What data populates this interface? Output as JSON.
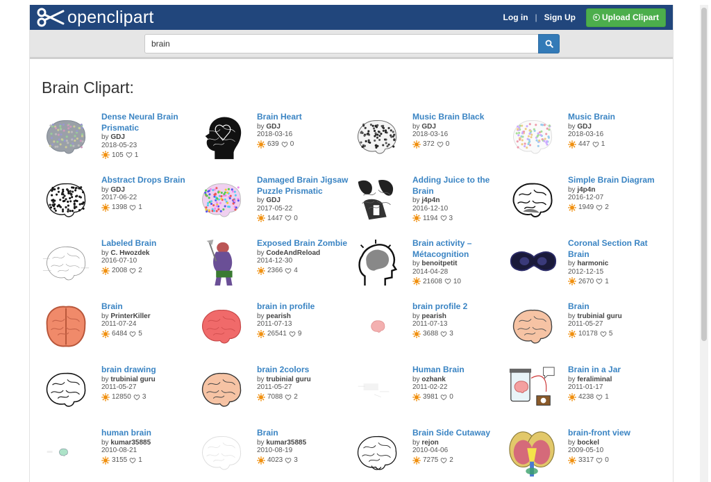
{
  "header": {
    "logo_text": "openclipart",
    "login_label": "Log in",
    "separator": "|",
    "signup_label": "Sign Up",
    "upload_label": "Upload Clipart"
  },
  "search": {
    "value": "brain"
  },
  "page": {
    "heading": "Brain Clipart:"
  },
  "colors": {
    "header_bg": "#21467c",
    "link": "#3a84c3",
    "upload_bg": "#4cae4c",
    "search_btn": "#337ab7"
  },
  "items": [
    {
      "title": "Dense Neural Brain Prismatic",
      "author": "GDJ",
      "date": "2018-05-23",
      "downloads": "105",
      "likes": "1",
      "icon": "prismatic-brain-thumbnail"
    },
    {
      "title": "Brain Heart",
      "author": "GDJ",
      "date": "2018-03-16",
      "downloads": "639",
      "likes": "0",
      "icon": "head-silhouette-heart-thumbnail"
    },
    {
      "title": "Music Brain Black",
      "author": "GDJ",
      "date": "2018-03-16",
      "downloads": "372",
      "likes": "0",
      "icon": "music-notes-brain-thumbnail"
    },
    {
      "title": "Music Brain",
      "author": "GDJ",
      "date": "2018-03-16",
      "downloads": "447",
      "likes": "1",
      "icon": "colorful-music-brain-thumbnail"
    },
    {
      "title": "Abstract Drops Brain",
      "author": "GDJ",
      "date": "2017-06-22",
      "downloads": "1398",
      "likes": "1",
      "icon": "drops-brain-thumbnail"
    },
    {
      "title": "Damaged Brain Jigsaw Puzzle Prismatic",
      "author": "GDJ",
      "date": "2017-05-22",
      "downloads": "1447",
      "likes": "0",
      "icon": "jigsaw-brain-thumbnail"
    },
    {
      "title": "Adding Juice to the Brain",
      "author": "j4p4n",
      "date": "2016-12-10",
      "downloads": "1194",
      "likes": "3",
      "icon": "juice-illustration-thumbnail"
    },
    {
      "title": "Simple Brain Diagram",
      "author": "j4p4n",
      "date": "2016-12-07",
      "downloads": "1949",
      "likes": "2",
      "icon": "brain-diagram-thumbnail"
    },
    {
      "title": "Labeled Brain",
      "author": "C. Hwozdek",
      "date": "2016-07-10",
      "downloads": "2008",
      "likes": "2",
      "icon": "labeled-brain-thumbnail"
    },
    {
      "title": "Exposed Brain Zombie",
      "author": "CodeAndReload",
      "date": "2014-12-30",
      "downloads": "2366",
      "likes": "4",
      "icon": "zombie-thumbnail"
    },
    {
      "title": "Brain activity – Métacognition",
      "author": "benoitpetit",
      "date": "2014-04-28",
      "downloads": "21608",
      "likes": "10",
      "icon": "head-outline-thumbnail"
    },
    {
      "title": "Coronal Section Rat Brain",
      "author": "harmonic",
      "date": "2012-12-15",
      "downloads": "2670",
      "likes": "1",
      "icon": "rat-brain-section-thumbnail"
    },
    {
      "title": "Brain",
      "author": "PrinterKiller",
      "date": "2011-07-24",
      "downloads": "6484",
      "likes": "5",
      "icon": "orange-brain-thumbnail"
    },
    {
      "title": "brain in profile",
      "author": "pearish",
      "date": "2011-07-13",
      "downloads": "26541",
      "likes": "9",
      "icon": "red-brain-profile-thumbnail"
    },
    {
      "title": "brain profile 2",
      "author": "pearish",
      "date": "2011-07-13",
      "downloads": "3688",
      "likes": "3",
      "icon": "small-brain-thumbnail"
    },
    {
      "title": "Brain",
      "author": "trubinial guru",
      "date": "2011-05-27",
      "downloads": "10178",
      "likes": "5",
      "icon": "peach-brain-thumbnail"
    },
    {
      "title": "brain drawing",
      "author": "trubinial guru",
      "date": "2011-05-27",
      "downloads": "12850",
      "likes": "3",
      "icon": "brain-drawing-thumbnail"
    },
    {
      "title": "brain 2colors",
      "author": "trubinial guru",
      "date": "2011-05-27",
      "downloads": "7088",
      "likes": "2",
      "icon": "peach-brain-2-thumbnail"
    },
    {
      "title": "Human Brain",
      "author": "ozhank",
      "date": "2011-02-22",
      "downloads": "3981",
      "likes": "0",
      "icon": "faint-brain-thumbnail"
    },
    {
      "title": "Brain in a Jar",
      "author": "feraliminal",
      "date": "2011-01-17",
      "downloads": "4238",
      "likes": "1",
      "icon": "brain-jar-thumbnail"
    },
    {
      "title": "human brain",
      "author": "kumar35885",
      "date": "2010-08-21",
      "downloads": "3155",
      "likes": "1",
      "icon": "tiny-brain-thumbnail"
    },
    {
      "title": "Brain",
      "author": "kumar35885",
      "date": "2010-08-19",
      "downloads": "4023",
      "likes": "3",
      "icon": "light-brain-outline-thumbnail"
    },
    {
      "title": "Brain Side Cutaway",
      "author": "rejon",
      "date": "2010-04-06",
      "downloads": "7275",
      "likes": "2",
      "icon": "brain-cutaway-thumbnail"
    },
    {
      "title": "brain-front view",
      "author": "bockel",
      "date": "2009-05-10",
      "downloads": "3317",
      "likes": "0",
      "icon": "brain-front-view-thumbnail"
    }
  ]
}
